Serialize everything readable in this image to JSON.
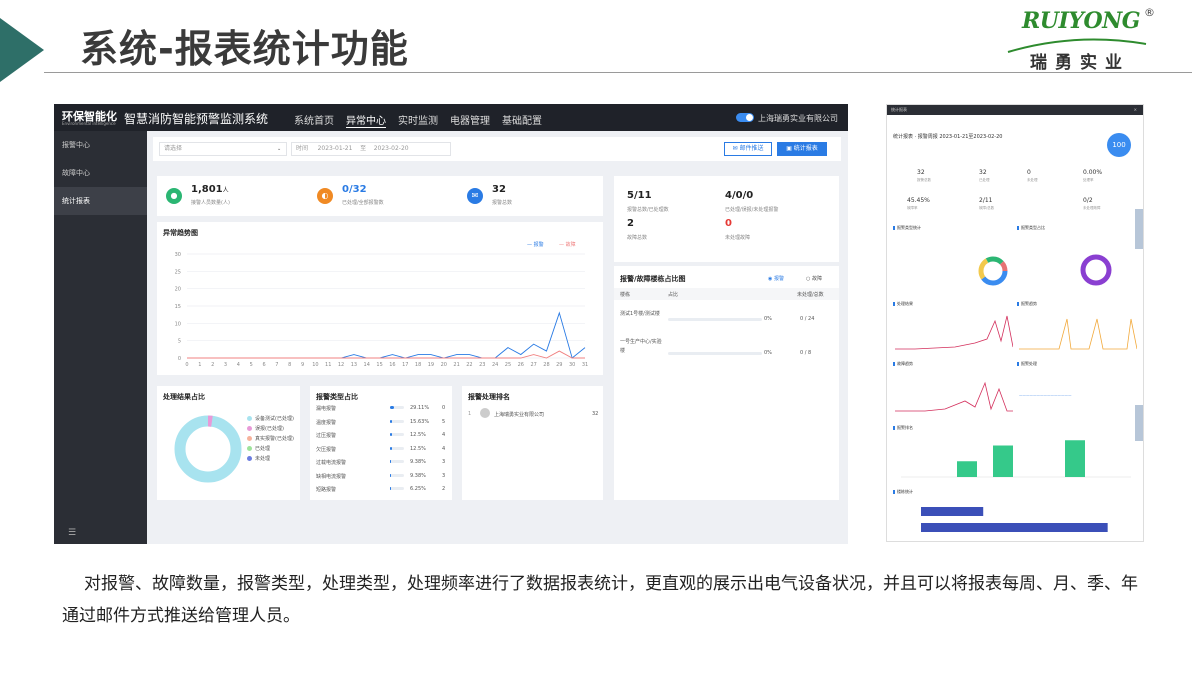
{
  "slide": {
    "title": "系统-报表统计功能",
    "caption": "对报警、故障数量，报警类型，处理类型，处理频率进行了数据报表统计，更直观的展示出电气设备状况，并且可以将报表每周、月、季、年通过邮件方式推送给管理人员。"
  },
  "logo": {
    "name": "RUIYONG",
    "reg": "®",
    "cn": "瑞勇实业"
  },
  "app": {
    "brand": "环保智能化",
    "brand_sub": "Environmental intelligence",
    "system_name": "智慧消防智能预警监测系统",
    "nav": [
      "系统首页",
      "异常中心",
      "实时监测",
      "电器管理",
      "基础配置"
    ],
    "company": "上海瑞勇实业有限公司",
    "sidebar": [
      "报警中心",
      "故障中心",
      "统计报表"
    ],
    "filter": {
      "select": "请选择",
      "date_label": "时间",
      "start": "2023-01-21",
      "sep": "至",
      "end": "2023-02-20",
      "mail_btn": "邮件推送",
      "stat_btn": "统计报表"
    },
    "stats": [
      {
        "value": "1,801",
        "unit": "人",
        "label": "接警人员数量(人)",
        "color": "#2bb673",
        "icon": "user-icon"
      },
      {
        "value": "0/32",
        "unit": "",
        "label": "已处理/全部报警数",
        "color": "#f08a24",
        "icon": "alarm-icon"
      },
      {
        "value": "32",
        "unit": "",
        "label": "报警总数",
        "color": "#2a7be4",
        "icon": "message-icon"
      }
    ],
    "right_stats": [
      {
        "value": "5/11",
        "label": "报警总数/已处理数"
      },
      {
        "value": "4/0/0",
        "label": "已处理/误报/未处理报警"
      },
      {
        "value": "2",
        "label": "故障总数"
      },
      {
        "value": "0",
        "label": "未处理故障"
      }
    ],
    "trend": {
      "title": "异常趋势图",
      "legend": [
        "报警",
        "故障"
      ],
      "y_ticks": [
        0,
        5,
        10,
        15,
        20,
        25,
        30
      ],
      "x_ticks": [
        0,
        1,
        2,
        3,
        4,
        5,
        6,
        7,
        8,
        9,
        10,
        11,
        12,
        13,
        14,
        15,
        16,
        17,
        18,
        19,
        20,
        21,
        22,
        23,
        24,
        25,
        26,
        27,
        28,
        29,
        30,
        31
      ]
    },
    "alarm_table": {
      "title": "报警/故障楼栋占比图",
      "radio": [
        "报警",
        "故障"
      ],
      "headers": [
        "楼栋",
        "占比",
        "未处理/总数"
      ],
      "rows": [
        {
          "name": "测试1号楼/测试楼",
          "pct": "0%",
          "count": "0 / 24",
          "fill": 0
        },
        {
          "name": "一号生产中心/实验楼",
          "pct": "0%",
          "count": "0 / 8",
          "fill": 0
        }
      ]
    },
    "process_result": {
      "title": "处理结果占比",
      "legend": [
        "设备测试(已处理)",
        "误报(已处理)",
        "真实报警(已处理)",
        "已处理",
        "未处理"
      ]
    },
    "alarm_type": {
      "title": "报警类型占比",
      "rows": [
        {
          "name": "漏电报警",
          "pct": "29.11%",
          "count": "0",
          "fill": 0.29
        },
        {
          "name": "温度报警",
          "pct": "15.63%",
          "count": "5",
          "fill": 0.16
        },
        {
          "name": "过压报警",
          "pct": "12.5%",
          "count": "4",
          "fill": 0.13
        },
        {
          "name": "欠压报警",
          "pct": "12.5%",
          "count": "4",
          "fill": 0.13
        },
        {
          "name": "过载电流报警",
          "pct": "9.38%",
          "count": "3",
          "fill": 0.09
        },
        {
          "name": "缺相电流报警",
          "pct": "9.38%",
          "count": "3",
          "fill": 0.09
        },
        {
          "name": "短路报警",
          "pct": "6.25%",
          "count": "2",
          "fill": 0.06
        }
      ]
    },
    "rank": {
      "title": "报警处理排名",
      "rows": [
        {
          "name": "上海瑞勇实业有限公司",
          "count": "32"
        }
      ]
    }
  },
  "mini": {
    "window_title": "统计报表",
    "report_title": "统计报表 · 报警周报 2023-01-21至2023-02-20",
    "score": "100",
    "grid": [
      {
        "value": "32",
        "label": "报警总数"
      },
      {
        "value": "32",
        "label": "已处理"
      },
      {
        "value": "0",
        "label": "未处理"
      },
      {
        "value": "0.00%",
        "label": "处理率"
      },
      {
        "value": "45.45%",
        "label": "故障率"
      },
      {
        "value": "2/11",
        "label": "故障/总数"
      },
      {
        "value": "0/2",
        "label": "未处理故障"
      }
    ],
    "sections": [
      "报警类型统计",
      "报警类型占比",
      "处理结果",
      "报警趋势",
      "故障趋势",
      "报警处理",
      "报警排名",
      "楼栋统计",
      "区域统计"
    ],
    "bar_chart": {
      "type": "bar",
      "values": [
        3,
        6,
        0,
        7
      ],
      "ylim": [
        0,
        8
      ]
    },
    "hbar_chart": {
      "type": "bar",
      "values": [
        14,
        42
      ],
      "xlim": [
        0,
        45
      ]
    }
  }
}
